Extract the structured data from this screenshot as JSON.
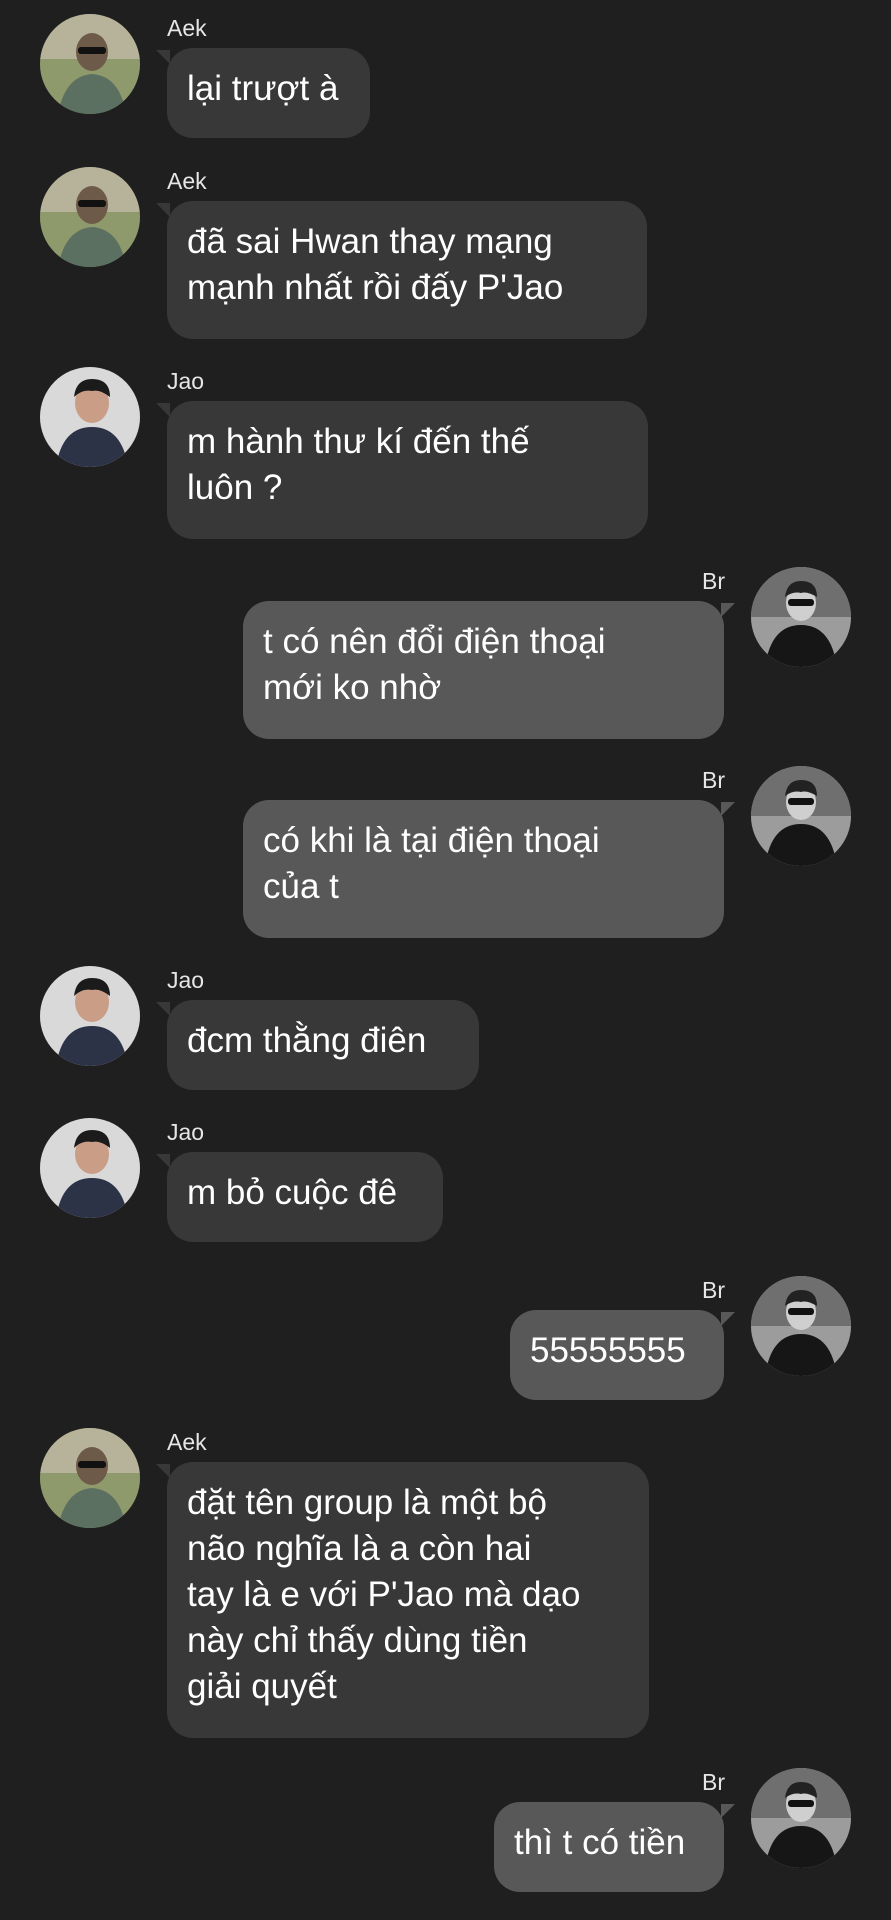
{
  "messages": [
    {
      "sender": "Aek",
      "direction": "incoming",
      "avatar": "aek-avatar",
      "text": "lại trượt à"
    },
    {
      "sender": "Aek",
      "direction": "incoming",
      "avatar": "aek-avatar",
      "text": "đã sai Hwan thay mạng\nmạnh nhất rồi đấy P'Jao"
    },
    {
      "sender": "Jao",
      "direction": "incoming",
      "avatar": "jao-avatar",
      "text": "m hành thư kí đến thế\nluôn ?"
    },
    {
      "sender": "Br",
      "direction": "outgoing",
      "avatar": "br-avatar",
      "text": "t có nên đổi điện thoại\nmới ko nhờ"
    },
    {
      "sender": "Br",
      "direction": "outgoing",
      "avatar": "br-avatar",
      "text": "có khi là tại điện thoại\ncủa t"
    },
    {
      "sender": "Jao",
      "direction": "incoming",
      "avatar": "jao-avatar",
      "text": "đcm thằng điên"
    },
    {
      "sender": "Jao",
      "direction": "incoming",
      "avatar": "jao-avatar",
      "text": "m bỏ cuộc đê"
    },
    {
      "sender": "Br",
      "direction": "outgoing",
      "avatar": "br-avatar",
      "text": "55555555"
    },
    {
      "sender": "Aek",
      "direction": "incoming",
      "avatar": "aek-avatar",
      "text": "đặt tên group là một bộ\nnão nghĩa là a còn hai\ntay là e với P'Jao mà dạo\nnày chỉ thấy dùng tiền\ngiải quyết"
    },
    {
      "sender": "Br",
      "direction": "outgoing",
      "avatar": "br-avatar",
      "text": "thì t có tiền"
    }
  ],
  "colors": {
    "background": "#1f1f1f",
    "incoming_bubble": "#383838",
    "outgoing_bubble": "#585858",
    "text": "#ffffff"
  }
}
